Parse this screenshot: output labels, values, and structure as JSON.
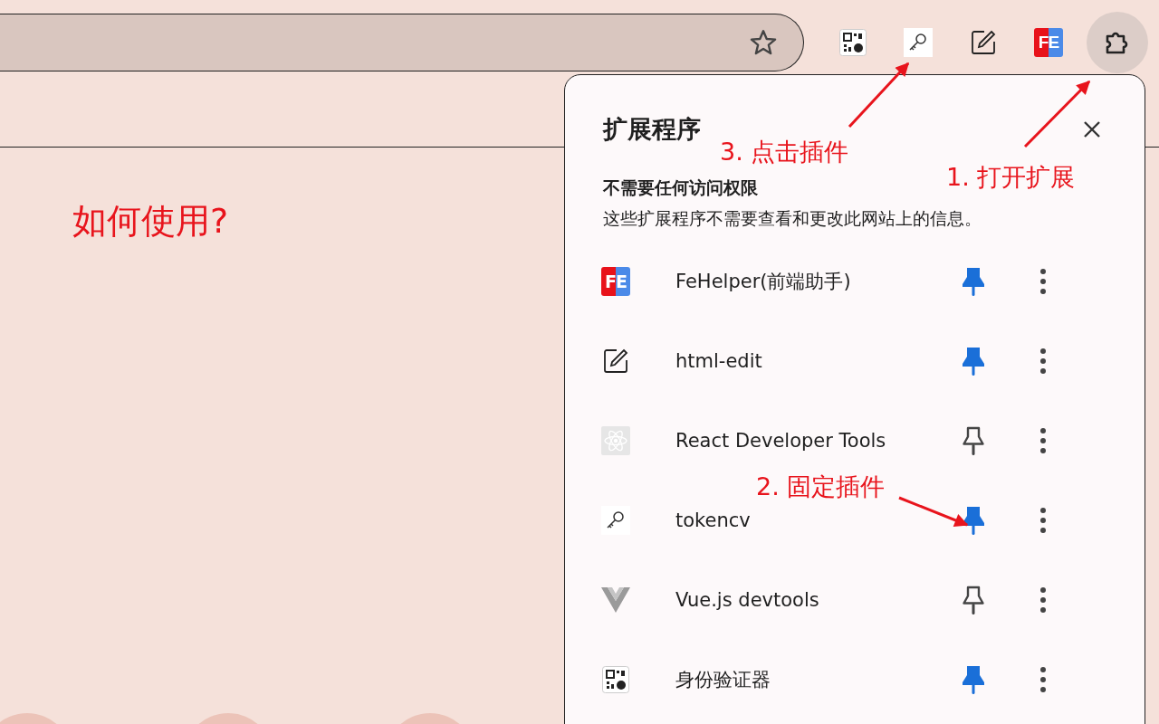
{
  "toolbar": {
    "icons": [
      {
        "kind": "qr",
        "selected": false
      },
      {
        "kind": "key",
        "selected": false
      },
      {
        "kind": "edit",
        "selected": false
      },
      {
        "kind": "fe",
        "text": "FE",
        "selected": false
      },
      {
        "kind": "extensions",
        "selected": true
      }
    ]
  },
  "page": {
    "heading": "如何使用?"
  },
  "extensions_popup": {
    "title": "扩展程序",
    "section_title": "不需要任何访问权限",
    "section_description": "这些扩展程序不需要查看和更改此网站上的信息。",
    "items": [
      {
        "name": "FeHelper(前端助手)",
        "kind": "fe",
        "icon_text": "FE",
        "pinned": true
      },
      {
        "name": "html-edit",
        "kind": "edit",
        "pinned": true
      },
      {
        "name": "React Developer Tools",
        "kind": "atom",
        "pinned": false
      },
      {
        "name": "tokencv",
        "kind": "key",
        "pinned": true
      },
      {
        "name": "Vue.js devtools",
        "kind": "vue",
        "pinned": false
      },
      {
        "name": "身份验证器",
        "kind": "qr",
        "pinned": true
      }
    ]
  },
  "annotations": [
    {
      "text": "3. 点击插件",
      "kind": "key"
    },
    {
      "text": "1. 打开扩展",
      "kind": "extensions"
    },
    {
      "text": "2. 固定插件",
      "kind": "pin"
    }
  ]
}
